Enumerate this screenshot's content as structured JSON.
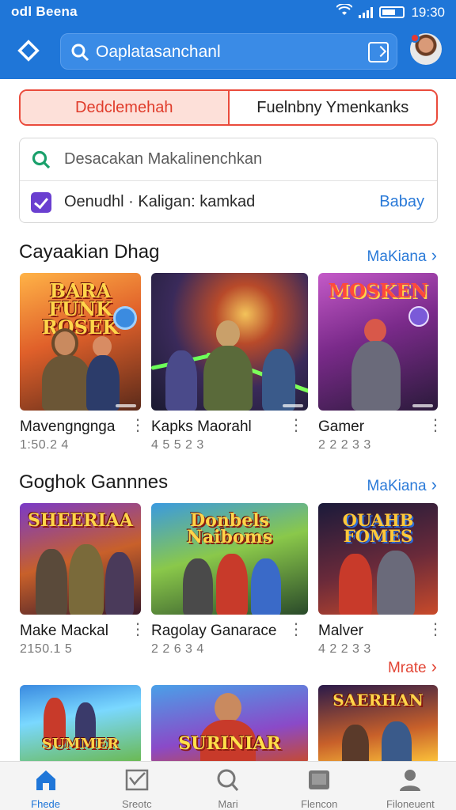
{
  "status_bar": {
    "left_text": "odl Beena",
    "time": "19:30"
  },
  "search": {
    "text": "Oaplatasanchanl"
  },
  "tabs": [
    {
      "label": "Dedclemehah",
      "active": true
    },
    {
      "label": "Fuelnbny Ymenkanks",
      "active": false
    }
  ],
  "card": {
    "row1_text": "Desacakan Makalinenchkan",
    "row2_text": "Oenudhl · Kaligan: kamkad",
    "row2_link": "Babay"
  },
  "sections": [
    {
      "title": "Cayaakian Dhag",
      "more": "MaKiana",
      "items": [
        {
          "name": "Mavengngnga",
          "sub": "1:50.2 4",
          "art": "BARA FUNK ROSEK"
        },
        {
          "name": "Kapks Maorahl",
          "sub": "4 5 5 2 3",
          "art": ""
        },
        {
          "name": "Gamer",
          "sub": "2 2 2 3 3",
          "art": "MOSKEN"
        }
      ]
    },
    {
      "title": "Goghok Gannnes",
      "more": "MaKiana",
      "items": [
        {
          "name": "Make Mackal",
          "sub": "2150.1 5",
          "art": "SHEERIAA"
        },
        {
          "name": "Ragolay Ganarace",
          "sub": "2 2 6 3 4",
          "art": "Donbels Naiboms"
        },
        {
          "name": "Malver",
          "sub": "4 2 2 3 3",
          "art": "OUAHB FOMES"
        }
      ]
    }
  ],
  "more_link": "Mrate",
  "third_row": [
    {
      "art": "SUMMER"
    },
    {
      "art": "SURINIAR"
    },
    {
      "art": "SAERHAN"
    }
  ],
  "bottom_nav": [
    {
      "label": "Fhede",
      "icon": "home-icon",
      "active": true
    },
    {
      "label": "Sreotc",
      "icon": "chart-icon",
      "active": false
    },
    {
      "label": "Mari",
      "icon": "search-icon",
      "active": false
    },
    {
      "label": "Flencon",
      "icon": "library-icon",
      "active": false
    },
    {
      "label": "Filoneuent",
      "icon": "profile-icon",
      "active": false
    }
  ],
  "colors": {
    "primary": "#1f76d8",
    "accent_red": "#ea4b3c",
    "link_blue": "#2a7ad8"
  }
}
